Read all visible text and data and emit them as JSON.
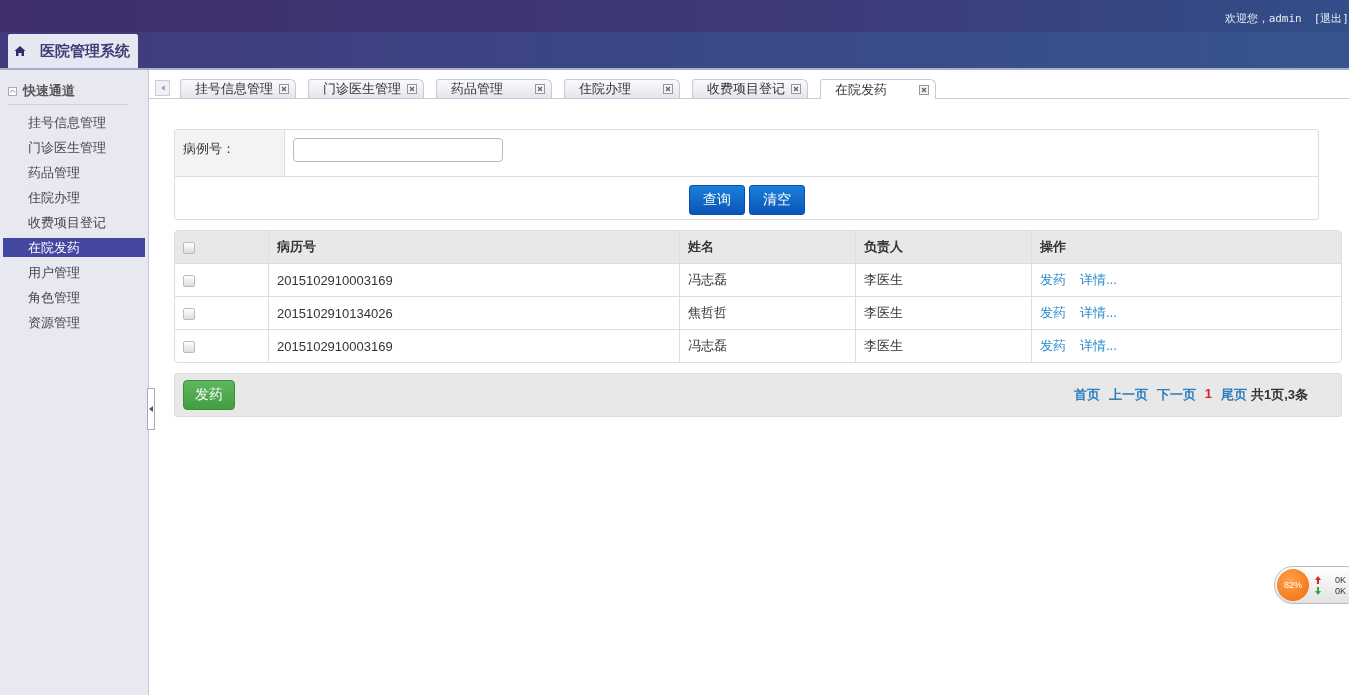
{
  "header": {
    "title": "医院管理系统",
    "welcome": "欢迎您，admin",
    "logout": "[退出]"
  },
  "sidebar": {
    "heading": "快速通道",
    "items": [
      {
        "label": "挂号信息管理",
        "selected": false
      },
      {
        "label": "门诊医生管理",
        "selected": false
      },
      {
        "label": "药品管理",
        "selected": false
      },
      {
        "label": "住院办理",
        "selected": false
      },
      {
        "label": "收费项目登记",
        "selected": false
      },
      {
        "label": "在院发药",
        "selected": true
      },
      {
        "label": "用户管理",
        "selected": false
      },
      {
        "label": "角色管理",
        "selected": false
      },
      {
        "label": "资源管理",
        "selected": false
      }
    ]
  },
  "tabs": [
    {
      "label": "挂号信息管理",
      "selected": false
    },
    {
      "label": "门诊医生管理",
      "selected": false
    },
    {
      "label": "药品管理",
      "selected": false
    },
    {
      "label": "住院办理",
      "selected": false
    },
    {
      "label": "收费项目登记",
      "selected": false
    },
    {
      "label": "在院发药",
      "selected": true
    }
  ],
  "search": {
    "label": "病例号：",
    "buttons": [
      "查询",
      "清空"
    ]
  },
  "table": {
    "columns": [
      "病历号",
      "姓名",
      "负责人",
      "操作"
    ],
    "header_checked": false,
    "rows": [
      {
        "checked": false,
        "cells": [
          "2015102910003169",
          "冯志磊",
          "李医生"
        ],
        "actions": [
          "发药",
          "详情..."
        ]
      },
      {
        "checked": false,
        "cells": [
          "2015102910134026",
          "焦哲哲",
          "李医生"
        ],
        "actions": [
          "发药",
          "详情..."
        ]
      },
      {
        "checked": false,
        "cells": [
          "2015102910003169",
          "冯志磊",
          "李医生"
        ],
        "actions": [
          "发药",
          "详情..."
        ]
      }
    ]
  },
  "footer": {
    "button": "发药",
    "pager": [
      {
        "label": "首页",
        "kind": "link"
      },
      {
        "label": "上一页",
        "kind": "link"
      },
      {
        "label": "下一页",
        "kind": "link"
      },
      {
        "label": "1",
        "kind": "current"
      },
      {
        "label": "尾页",
        "kind": "link"
      },
      {
        "label": "共1页,3条",
        "kind": "text"
      }
    ]
  },
  "net_widget": {
    "percent": "82%",
    "up": "0K",
    "down": "0K"
  }
}
